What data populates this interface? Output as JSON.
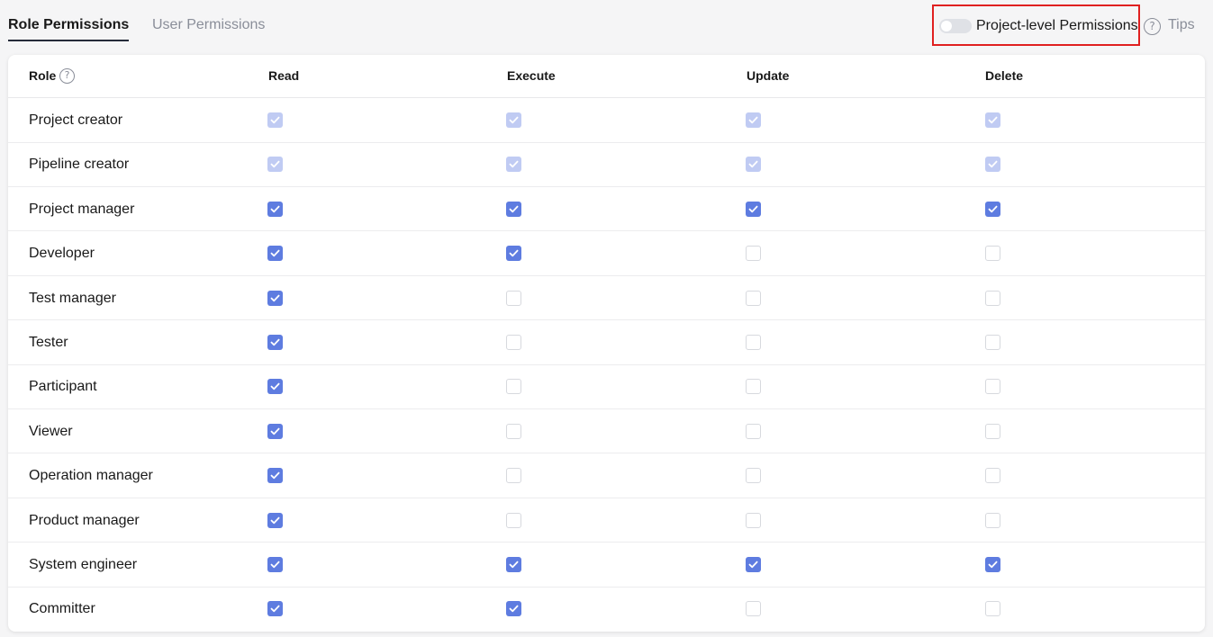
{
  "tabs": [
    {
      "label": "Role Permissions",
      "active": true
    },
    {
      "label": "User Permissions",
      "active": false
    }
  ],
  "toolbar": {
    "project_level_label": "Project-level Permissions",
    "project_level_enabled": false,
    "tips_label": "Tips"
  },
  "colors": {
    "checked": "#5e7ce0",
    "checked_disabled": "#c0cbf3",
    "highlight_border": "#e02020"
  },
  "table": {
    "headers": {
      "role": "Role",
      "read": "Read",
      "execute": "Execute",
      "update": "Update",
      "delete": "Delete"
    },
    "rows": [
      {
        "role": "Project creator",
        "perms": [
          "disabled",
          "disabled",
          "disabled",
          "disabled"
        ]
      },
      {
        "role": "Pipeline creator",
        "perms": [
          "disabled",
          "disabled",
          "disabled",
          "disabled"
        ]
      },
      {
        "role": "Project manager",
        "perms": [
          "checked",
          "checked",
          "checked",
          "checked"
        ]
      },
      {
        "role": "Developer",
        "perms": [
          "checked",
          "checked",
          "unchecked",
          "unchecked"
        ]
      },
      {
        "role": "Test manager",
        "perms": [
          "checked",
          "unchecked",
          "unchecked",
          "unchecked"
        ]
      },
      {
        "role": "Tester",
        "perms": [
          "checked",
          "unchecked",
          "unchecked",
          "unchecked"
        ]
      },
      {
        "role": "Participant",
        "perms": [
          "checked",
          "unchecked",
          "unchecked",
          "unchecked"
        ]
      },
      {
        "role": "Viewer",
        "perms": [
          "checked",
          "unchecked",
          "unchecked",
          "unchecked"
        ]
      },
      {
        "role": "Operation manager",
        "perms": [
          "checked",
          "unchecked",
          "unchecked",
          "unchecked"
        ]
      },
      {
        "role": "Product manager",
        "perms": [
          "checked",
          "unchecked",
          "unchecked",
          "unchecked"
        ]
      },
      {
        "role": "System engineer",
        "perms": [
          "checked",
          "checked",
          "checked",
          "checked"
        ]
      },
      {
        "role": "Committer",
        "perms": [
          "checked",
          "checked",
          "unchecked",
          "unchecked"
        ]
      }
    ]
  }
}
